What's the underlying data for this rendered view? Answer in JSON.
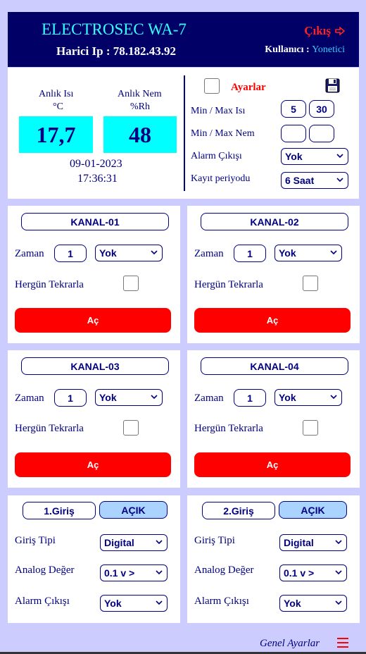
{
  "header": {
    "title": "ELECTROSEC WA-7",
    "ip": "Harici Ip : 78.182.43.92",
    "logout_label": "Çıkış",
    "user_label": "Kullanıcı :",
    "user_value": "Yonetici"
  },
  "status": {
    "temp_label": "Anlık Isı",
    "temp_unit": "°C",
    "temp_value": "17,7",
    "hum_label": "Anlık Nem",
    "hum_unit": "%Rh",
    "hum_value": "48",
    "date": "09-01-2023",
    "time": "17:36:31"
  },
  "settings": {
    "title": "Ayarlar",
    "minmax_temp_label": "Min / Max Isı",
    "min_temp": "5",
    "max_temp": "30",
    "minmax_hum_label": "Min / Max Nem",
    "min_hum": "",
    "max_hum": "",
    "alarm_label": "Alarm Çıkışı",
    "alarm_value": "Yok",
    "record_label": "Kayıt periyodu",
    "record_value": "6 Saat"
  },
  "channels": [
    {
      "title": "KANAL-01",
      "time_label": "Zaman",
      "time_value": "1",
      "unit_value": "Yok",
      "repeat_label": "Hergün Tekrarla",
      "button_label": "Aç"
    },
    {
      "title": "KANAL-02",
      "time_label": "Zaman",
      "time_value": "1",
      "unit_value": "Yok",
      "repeat_label": "Hergün Tekrarla",
      "button_label": "Aç"
    },
    {
      "title": "KANAL-03",
      "time_label": "Zaman",
      "time_value": "1",
      "unit_value": "Yok",
      "repeat_label": "Hergün Tekrarla",
      "button_label": "Aç"
    },
    {
      "title": "KANAL-04",
      "time_label": "Zaman",
      "time_value": "1",
      "unit_value": "Yok",
      "repeat_label": "Hergün Tekrarla",
      "button_label": "Aç"
    }
  ],
  "inputs": [
    {
      "title": "1.Giriş",
      "state": "AÇIK",
      "type_label": "Giriş Tipi",
      "type_value": "Digital",
      "analog_label": "Analog Değer",
      "analog_value": "0.1 v >",
      "alarm_label": "Alarm Çıkışı",
      "alarm_value": "Yok"
    },
    {
      "title": "2.Giriş",
      "state": "AÇIK",
      "type_label": "Giriş Tipi",
      "type_value": "Digital",
      "analog_label": "Analog Değer",
      "analog_value": "0.1 v >",
      "alarm_label": "Alarm Çıkışı",
      "alarm_value": "Yok"
    }
  ],
  "footer": {
    "general_settings": "Genel Ayarlar"
  },
  "colors": {
    "header_bg": "#000066",
    "accent_cyan": "#00ffff",
    "danger_red": "#ff0000",
    "text_navy": "#000080"
  }
}
